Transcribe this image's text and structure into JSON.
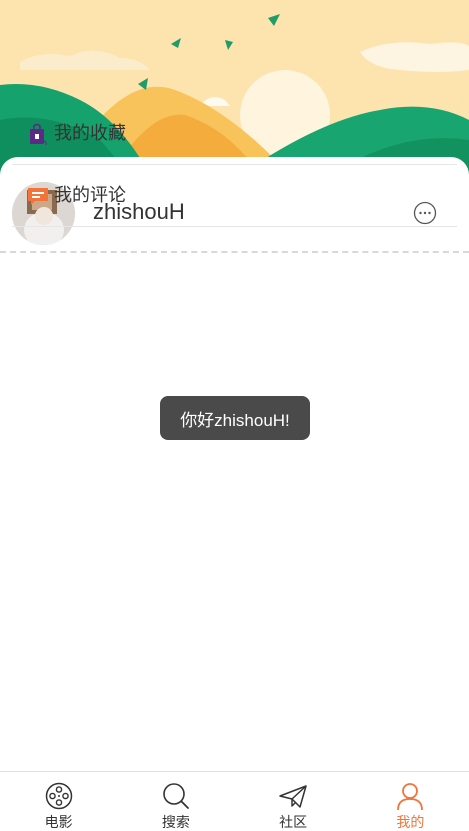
{
  "profile": {
    "username": "zhishouH"
  },
  "menu": {
    "items": [
      {
        "label": "我的收藏",
        "icon": "bag-icon"
      },
      {
        "label": "我的评论",
        "icon": "comment-icon"
      }
    ]
  },
  "toast": {
    "text": "你好zhishouH!"
  },
  "tabbar": {
    "tabs": [
      {
        "label": "电影",
        "icon": "film-reel-icon",
        "active": false
      },
      {
        "label": "搜索",
        "icon": "search-icon",
        "active": false
      },
      {
        "label": "社区",
        "icon": "paper-plane-icon",
        "active": false
      },
      {
        "label": "我的",
        "icon": "user-icon",
        "active": true
      }
    ]
  },
  "colors": {
    "accent": "#f2743a",
    "toast_bg": "#4a4a4a",
    "sky": "#fde4b0",
    "hill_green": "#16a26c",
    "hill_yellow": "#f8c35a"
  }
}
